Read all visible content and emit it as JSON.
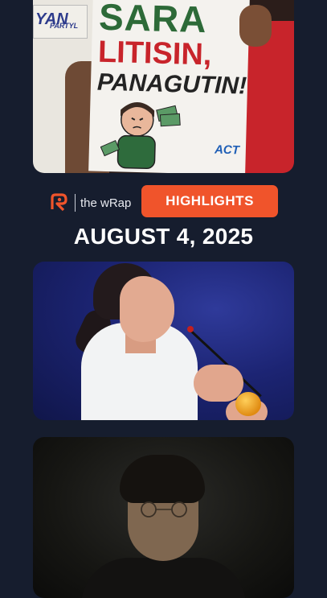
{
  "placard": {
    "line1": "SARA",
    "line2": "LITISIN,",
    "line3": "PANAGUTIN!",
    "small_sign": "YAN",
    "small_sign_sub": "PARTYL",
    "logo": "ACT"
  },
  "brand": {
    "wrap_label": "the wRap",
    "highlights_label": "HIGHLIGHTS"
  },
  "date": "AUGUST 4, 2025",
  "colors": {
    "background": "#161d2e",
    "accent": "#f0542b",
    "placard_green": "#2d6a38",
    "placard_red": "#c8242b"
  }
}
